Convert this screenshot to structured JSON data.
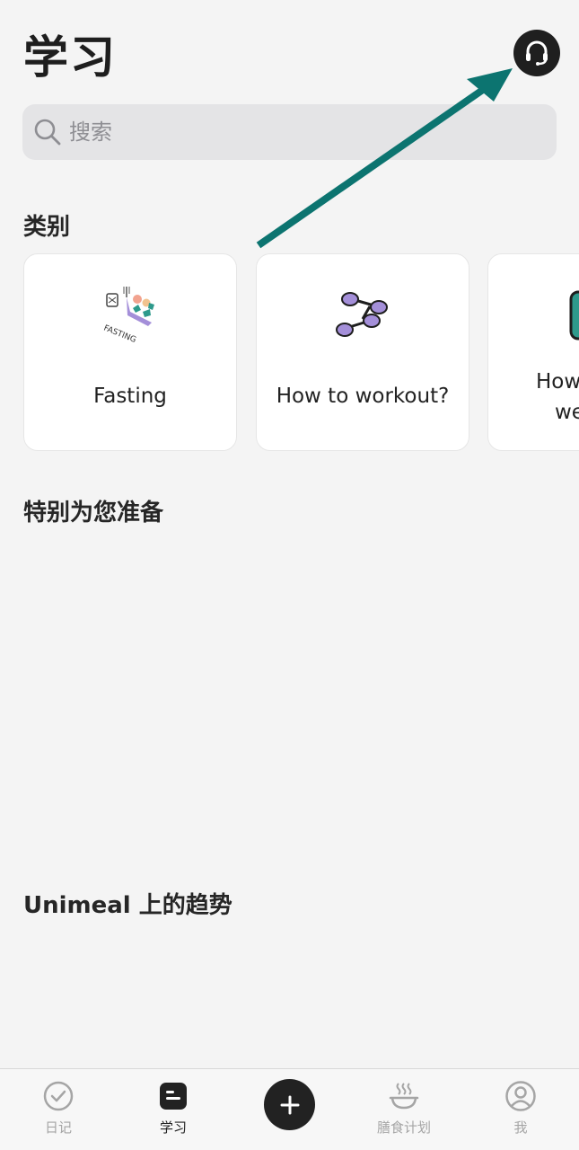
{
  "header": {
    "title": "学习",
    "support_icon": "headset-icon"
  },
  "search": {
    "placeholder": "搜索",
    "icon": "search-icon"
  },
  "categories_section": {
    "title": "类别",
    "cards": [
      {
        "label": "Fasting",
        "icon": "fasting-illustration",
        "logo_text": "FASTING"
      },
      {
        "label": "How to workout?",
        "icon": "dumbbells-illustration"
      },
      {
        "label_line1": "How",
        "label_line2": "we",
        "icon": "scale-illustration"
      }
    ]
  },
  "for_you_section": {
    "title": "特别为您准备"
  },
  "trending_section": {
    "title": "Unimeal 上的趋势"
  },
  "tab_bar": {
    "items": [
      {
        "label": "日记",
        "icon": "check-circle-icon",
        "active": false
      },
      {
        "label": "学习",
        "icon": "learn-icon",
        "active": true
      },
      {
        "label": "",
        "icon": "plus-icon"
      },
      {
        "label": "膳食计划",
        "icon": "bowl-icon",
        "active": false
      },
      {
        "label": "我",
        "icon": "profile-icon",
        "active": false
      }
    ]
  },
  "colors": {
    "background": "#f4f4f4",
    "annotation_arrow": "#0c7470",
    "dumbbell": "#a48fd9",
    "tab_active": "#222222",
    "tab_inactive": "#a5a5a5"
  }
}
